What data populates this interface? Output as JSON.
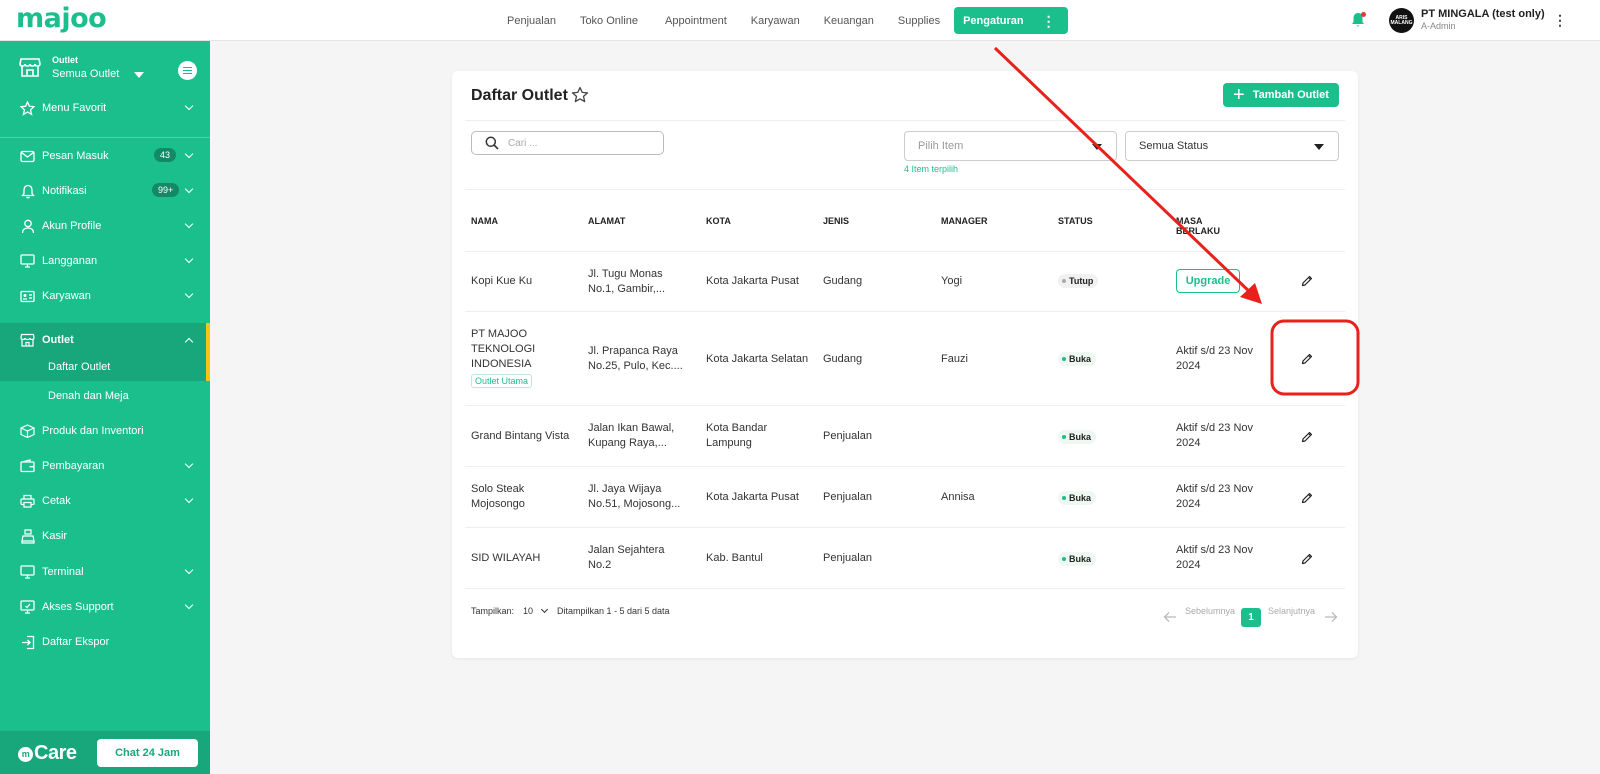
{
  "app": {
    "logo": "majoo"
  },
  "topnav": {
    "items": [
      "Penjualan",
      "Toko Online",
      "Appointment",
      "Karyawan",
      "Keuangan",
      "Supplies"
    ],
    "active": "Pengaturan",
    "active_more_icon": "⋮"
  },
  "user": {
    "company": "PT MINGALA (test only)",
    "role": "A-Admin",
    "avatar_text": "ARIS MALANG",
    "menu_icon": "⋮"
  },
  "sidebar": {
    "outlet_label": "Outlet",
    "outlet_value": "Semua Outlet",
    "items": [
      {
        "label": "Menu Favorit",
        "icon": "star-icon"
      },
      {
        "label": "Pesan Masuk",
        "icon": "mail-icon",
        "badge": "43"
      },
      {
        "label": "Notifikasi",
        "icon": "bell-icon",
        "badge": "99+"
      },
      {
        "label": "Akun Profile",
        "icon": "user-icon"
      },
      {
        "label": "Langganan",
        "icon": "monitor-icon"
      },
      {
        "label": "Karyawan",
        "icon": "id-card-icon"
      },
      {
        "label": "Outlet",
        "icon": "store-icon"
      },
      {
        "label": "Produk dan Inventori",
        "icon": "box-icon"
      },
      {
        "label": "Pembayaran",
        "icon": "wallet-icon"
      },
      {
        "label": "Cetak",
        "icon": "printer-icon"
      },
      {
        "label": "Kasir",
        "icon": "cashier-icon"
      },
      {
        "label": "Terminal",
        "icon": "terminal-icon"
      },
      {
        "label": "Akses Support",
        "icon": "support-icon"
      },
      {
        "label": "Daftar Ekspor",
        "icon": "export-icon"
      }
    ],
    "sub_items": [
      "Daftar Outlet",
      "Denah dan Meja"
    ],
    "care_logo": "Care",
    "care_logo_m": "m",
    "chat_button": "Chat 24 Jam"
  },
  "page": {
    "title": "Daftar Outlet",
    "add_button": "Tambah Outlet",
    "search_placeholder": "Cari ...",
    "filter_item_placeholder": "Pilih Item",
    "filter_status": "Semua Status",
    "picked_text": "4 Item terpilih",
    "columns": [
      "NAMA",
      "ALAMAT",
      "KOTA",
      "JENIS",
      "MANAGER",
      "STATUS",
      "MASA BERLAKU"
    ],
    "rows": [
      {
        "nama": "Kopi Kue Ku",
        "alamat": "Jl. Tugu Monas No.1, Gambir,...",
        "kota": "Kota Jakarta Pusat",
        "jenis": "Gudang",
        "manager": "Yogi",
        "status": "Tutup",
        "masa": "",
        "action": "Upgrade"
      },
      {
        "nama": "PT MAJOO TEKNOLOGI INDONESIA",
        "tag": "Outlet Utama",
        "alamat": "Jl. Prapanca Raya No.25, Pulo, Kec....",
        "kota": "Kota Jakarta Selatan",
        "jenis": "Gudang",
        "manager": "Fauzi",
        "status": "Buka",
        "masa": "Aktif s/d 23 Nov 2024"
      },
      {
        "nama": "Grand Bintang Vista",
        "alamat": "Jalan Ikan Bawal, Kupang Raya,...",
        "kota": "Kota Bandar Lampung",
        "jenis": "Penjualan",
        "manager": "",
        "status": "Buka",
        "masa": "Aktif s/d 23 Nov 2024"
      },
      {
        "nama": "Solo Steak Mojosongo",
        "alamat": "Jl. Jaya Wijaya No.51, Mojosong...",
        "kota": "Kota Jakarta Pusat",
        "jenis": "Penjualan",
        "manager": "Annisa",
        "status": "Buka",
        "masa": "Aktif s/d 23 Nov 2024"
      },
      {
        "nama": "SID WILAYAH",
        "alamat": "Jalan Sejahtera No.2",
        "kota": "Kab. Bantul",
        "jenis": "Penjualan",
        "manager": "",
        "status": "Buka",
        "masa": "Aktif s/d 23 Nov 2024"
      }
    ],
    "footer": {
      "show_label": "Tampilkan:",
      "show_value": "10",
      "summary": "Ditampilkan 1 - 5 dari 5 data",
      "prev": "Sebelumnya",
      "page": "1",
      "next": "Selanjutnya"
    }
  },
  "colors": {
    "brand": "#1bbf8c",
    "annotation": "#e8211d",
    "active_marker": "#f5c518"
  }
}
